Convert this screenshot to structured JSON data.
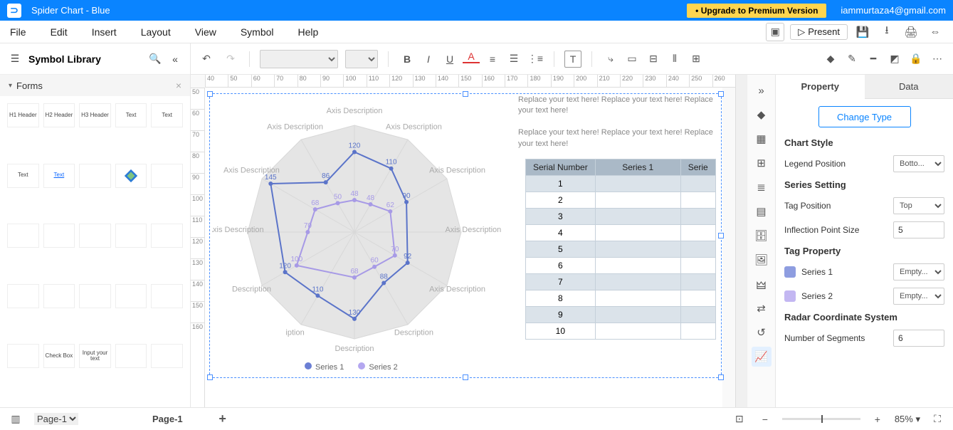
{
  "title": "Spider Chart - Blue",
  "upgrade_label": "• Upgrade to Premium Version",
  "user_email": "iammurtaza4@gmail.com",
  "menu": [
    "File",
    "Edit",
    "Insert",
    "Layout",
    "View",
    "Symbol",
    "Help"
  ],
  "present_label": "Present",
  "symbol_library_title": "Symbol Library",
  "forms_section": "Forms",
  "lib_items": [
    "H1 Header",
    "H2 Header",
    "H3 Header",
    "Text",
    "Text",
    "Text",
    "Text",
    "",
    "",
    "",
    "",
    "",
    "",
    "",
    "",
    "",
    "",
    "",
    "",
    "",
    "",
    "Check Box",
    "Input your text",
    "",
    ""
  ],
  "hruler_ticks": [
    "40",
    "50",
    "60",
    "70",
    "80",
    "90",
    "100",
    "110",
    "120",
    "130",
    "140",
    "150",
    "160",
    "170",
    "180",
    "190",
    "200",
    "210",
    "220",
    "230",
    "240",
    "250",
    "260"
  ],
  "vruler_ticks": [
    "50",
    "60",
    "70",
    "80",
    "90",
    "100",
    "110",
    "120",
    "130",
    "140",
    "150",
    "160"
  ],
  "placeholder_text": "Replace your text here!  Replace your text here!  Replace your text here!",
  "table": {
    "headers": [
      "Serial Number",
      "Series 1",
      "Serie"
    ],
    "rows": [
      "1",
      "2",
      "3",
      "4",
      "5",
      "6",
      "7",
      "8",
      "9",
      "10"
    ]
  },
  "chart_data": {
    "type": "radar",
    "title": "",
    "axes": [
      "Axis Description",
      "Axis Description",
      "Axis Description",
      "Axis Description",
      "Axis Description",
      "Description",
      "Description",
      "iption",
      "Description",
      "Axis Description",
      "Axis Description",
      "Axis Description"
    ],
    "rings": [
      40,
      80,
      120,
      160
    ],
    "series": [
      {
        "name": "Series 1",
        "color": "#5b74c9",
        "values": [
          120,
          110,
          90,
          null,
          92,
          88,
          130,
          110,
          120,
          null,
          145,
          86
        ],
        "labels": [
          120,
          110,
          90,
          null,
          92,
          88,
          130,
          110,
          120,
          null,
          145,
          86
        ]
      },
      {
        "name": "Series 2",
        "color": "#a79ae6",
        "values": [
          48,
          48,
          62,
          null,
          70,
          60,
          68,
          null,
          100,
          70,
          68,
          50
        ],
        "labels": [
          50,
          48,
          48,
          62,
          null,
          70,
          60,
          68,
          null,
          100,
          70,
          68
        ]
      }
    ]
  },
  "legend": [
    {
      "name": "Series 1",
      "color": "#6b7fd4"
    },
    {
      "name": "Series 2",
      "color": "#b4a7f0"
    }
  ],
  "right": {
    "tabs": [
      "Property",
      "Data"
    ],
    "change_type": "Change Type",
    "chart_style": "Chart Style",
    "legend_position_label": "Legend Position",
    "legend_position_value": "Botto...",
    "series_setting": "Series Setting",
    "tag_position_label": "Tag Position",
    "tag_position_value": "Top",
    "inflection_label": "Inflection Point Size",
    "inflection_value": "5",
    "tag_property": "Tag Property",
    "series_rows": [
      {
        "name": "Series 1",
        "color": "#8e9de0",
        "value": "Empty..."
      },
      {
        "name": "Series 2",
        "color": "#c3b7f2",
        "value": "Empty..."
      }
    ],
    "radar_sys": "Radar Coordinate System",
    "num_segments_label": "Number of Segments",
    "num_segments_value": "6"
  },
  "bottom": {
    "page_select": "Page-1",
    "current_page": "Page-1",
    "zoom": "85%"
  },
  "sidestrip_icons": [
    "expand",
    "paint",
    "grid",
    "apps",
    "layers",
    "layout",
    "db",
    "image",
    "org",
    "random",
    "history",
    "chart"
  ]
}
